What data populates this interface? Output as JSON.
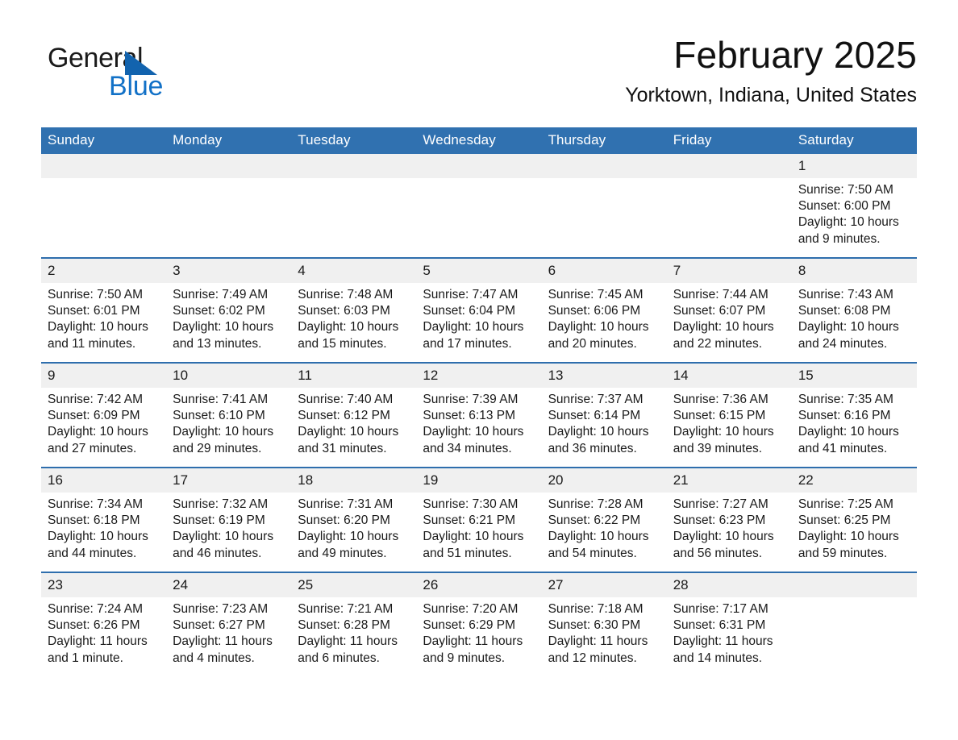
{
  "brand": {
    "name_part1": "General",
    "name_part2": "Blue",
    "triangle_color": "#1263ae",
    "blue_text_color": "#1271c7"
  },
  "header": {
    "month_title": "February 2025",
    "location": "Yorktown, Indiana, United States"
  },
  "theme": {
    "header_blue": "#3071b0",
    "row_separator": "#2e6ead",
    "daynum_bg": "#f0f0f0"
  },
  "weekday_headers": [
    "Sunday",
    "Monday",
    "Tuesday",
    "Wednesday",
    "Thursday",
    "Friday",
    "Saturday"
  ],
  "weeks": [
    [
      {
        "day": "",
        "sunrise": "",
        "sunset": "",
        "daylight_line1": "",
        "daylight_line2": ""
      },
      {
        "day": "",
        "sunrise": "",
        "sunset": "",
        "daylight_line1": "",
        "daylight_line2": ""
      },
      {
        "day": "",
        "sunrise": "",
        "sunset": "",
        "daylight_line1": "",
        "daylight_line2": ""
      },
      {
        "day": "",
        "sunrise": "",
        "sunset": "",
        "daylight_line1": "",
        "daylight_line2": ""
      },
      {
        "day": "",
        "sunrise": "",
        "sunset": "",
        "daylight_line1": "",
        "daylight_line2": ""
      },
      {
        "day": "",
        "sunrise": "",
        "sunset": "",
        "daylight_line1": "",
        "daylight_line2": ""
      },
      {
        "day": "1",
        "sunrise": "Sunrise: 7:50 AM",
        "sunset": "Sunset: 6:00 PM",
        "daylight_line1": "Daylight: 10 hours",
        "daylight_line2": "and 9 minutes."
      }
    ],
    [
      {
        "day": "2",
        "sunrise": "Sunrise: 7:50 AM",
        "sunset": "Sunset: 6:01 PM",
        "daylight_line1": "Daylight: 10 hours",
        "daylight_line2": "and 11 minutes."
      },
      {
        "day": "3",
        "sunrise": "Sunrise: 7:49 AM",
        "sunset": "Sunset: 6:02 PM",
        "daylight_line1": "Daylight: 10 hours",
        "daylight_line2": "and 13 minutes."
      },
      {
        "day": "4",
        "sunrise": "Sunrise: 7:48 AM",
        "sunset": "Sunset: 6:03 PM",
        "daylight_line1": "Daylight: 10 hours",
        "daylight_line2": "and 15 minutes."
      },
      {
        "day": "5",
        "sunrise": "Sunrise: 7:47 AM",
        "sunset": "Sunset: 6:04 PM",
        "daylight_line1": "Daylight: 10 hours",
        "daylight_line2": "and 17 minutes."
      },
      {
        "day": "6",
        "sunrise": "Sunrise: 7:45 AM",
        "sunset": "Sunset: 6:06 PM",
        "daylight_line1": "Daylight: 10 hours",
        "daylight_line2": "and 20 minutes."
      },
      {
        "day": "7",
        "sunrise": "Sunrise: 7:44 AM",
        "sunset": "Sunset: 6:07 PM",
        "daylight_line1": "Daylight: 10 hours",
        "daylight_line2": "and 22 minutes."
      },
      {
        "day": "8",
        "sunrise": "Sunrise: 7:43 AM",
        "sunset": "Sunset: 6:08 PM",
        "daylight_line1": "Daylight: 10 hours",
        "daylight_line2": "and 24 minutes."
      }
    ],
    [
      {
        "day": "9",
        "sunrise": "Sunrise: 7:42 AM",
        "sunset": "Sunset: 6:09 PM",
        "daylight_line1": "Daylight: 10 hours",
        "daylight_line2": "and 27 minutes."
      },
      {
        "day": "10",
        "sunrise": "Sunrise: 7:41 AM",
        "sunset": "Sunset: 6:10 PM",
        "daylight_line1": "Daylight: 10 hours",
        "daylight_line2": "and 29 minutes."
      },
      {
        "day": "11",
        "sunrise": "Sunrise: 7:40 AM",
        "sunset": "Sunset: 6:12 PM",
        "daylight_line1": "Daylight: 10 hours",
        "daylight_line2": "and 31 minutes."
      },
      {
        "day": "12",
        "sunrise": "Sunrise: 7:39 AM",
        "sunset": "Sunset: 6:13 PM",
        "daylight_line1": "Daylight: 10 hours",
        "daylight_line2": "and 34 minutes."
      },
      {
        "day": "13",
        "sunrise": "Sunrise: 7:37 AM",
        "sunset": "Sunset: 6:14 PM",
        "daylight_line1": "Daylight: 10 hours",
        "daylight_line2": "and 36 minutes."
      },
      {
        "day": "14",
        "sunrise": "Sunrise: 7:36 AM",
        "sunset": "Sunset: 6:15 PM",
        "daylight_line1": "Daylight: 10 hours",
        "daylight_line2": "and 39 minutes."
      },
      {
        "day": "15",
        "sunrise": "Sunrise: 7:35 AM",
        "sunset": "Sunset: 6:16 PM",
        "daylight_line1": "Daylight: 10 hours",
        "daylight_line2": "and 41 minutes."
      }
    ],
    [
      {
        "day": "16",
        "sunrise": "Sunrise: 7:34 AM",
        "sunset": "Sunset: 6:18 PM",
        "daylight_line1": "Daylight: 10 hours",
        "daylight_line2": "and 44 minutes."
      },
      {
        "day": "17",
        "sunrise": "Sunrise: 7:32 AM",
        "sunset": "Sunset: 6:19 PM",
        "daylight_line1": "Daylight: 10 hours",
        "daylight_line2": "and 46 minutes."
      },
      {
        "day": "18",
        "sunrise": "Sunrise: 7:31 AM",
        "sunset": "Sunset: 6:20 PM",
        "daylight_line1": "Daylight: 10 hours",
        "daylight_line2": "and 49 minutes."
      },
      {
        "day": "19",
        "sunrise": "Sunrise: 7:30 AM",
        "sunset": "Sunset: 6:21 PM",
        "daylight_line1": "Daylight: 10 hours",
        "daylight_line2": "and 51 minutes."
      },
      {
        "day": "20",
        "sunrise": "Sunrise: 7:28 AM",
        "sunset": "Sunset: 6:22 PM",
        "daylight_line1": "Daylight: 10 hours",
        "daylight_line2": "and 54 minutes."
      },
      {
        "day": "21",
        "sunrise": "Sunrise: 7:27 AM",
        "sunset": "Sunset: 6:23 PM",
        "daylight_line1": "Daylight: 10 hours",
        "daylight_line2": "and 56 minutes."
      },
      {
        "day": "22",
        "sunrise": "Sunrise: 7:25 AM",
        "sunset": "Sunset: 6:25 PM",
        "daylight_line1": "Daylight: 10 hours",
        "daylight_line2": "and 59 minutes."
      }
    ],
    [
      {
        "day": "23",
        "sunrise": "Sunrise: 7:24 AM",
        "sunset": "Sunset: 6:26 PM",
        "daylight_line1": "Daylight: 11 hours",
        "daylight_line2": "and 1 minute."
      },
      {
        "day": "24",
        "sunrise": "Sunrise: 7:23 AM",
        "sunset": "Sunset: 6:27 PM",
        "daylight_line1": "Daylight: 11 hours",
        "daylight_line2": "and 4 minutes."
      },
      {
        "day": "25",
        "sunrise": "Sunrise: 7:21 AM",
        "sunset": "Sunset: 6:28 PM",
        "daylight_line1": "Daylight: 11 hours",
        "daylight_line2": "and 6 minutes."
      },
      {
        "day": "26",
        "sunrise": "Sunrise: 7:20 AM",
        "sunset": "Sunset: 6:29 PM",
        "daylight_line1": "Daylight: 11 hours",
        "daylight_line2": "and 9 minutes."
      },
      {
        "day": "27",
        "sunrise": "Sunrise: 7:18 AM",
        "sunset": "Sunset: 6:30 PM",
        "daylight_line1": "Daylight: 11 hours",
        "daylight_line2": "and 12 minutes."
      },
      {
        "day": "28",
        "sunrise": "Sunrise: 7:17 AM",
        "sunset": "Sunset: 6:31 PM",
        "daylight_line1": "Daylight: 11 hours",
        "daylight_line2": "and 14 minutes."
      },
      {
        "day": "",
        "sunrise": "",
        "sunset": "",
        "daylight_line1": "",
        "daylight_line2": ""
      }
    ]
  ]
}
